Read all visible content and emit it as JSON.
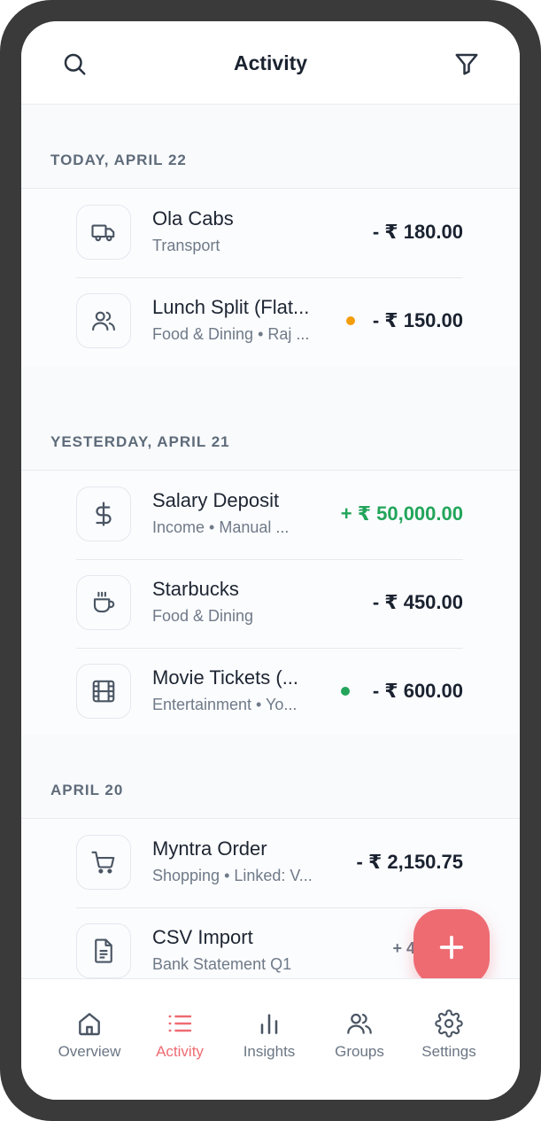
{
  "header": {
    "title": "Activity"
  },
  "icons": {
    "search": "search-icon",
    "filter": "filter-icon"
  },
  "sections": [
    {
      "label": "TODAY, APRIL 22",
      "items": [
        {
          "icon": "truck-icon",
          "title": "Ola Cabs",
          "subtitle": "Transport",
          "amount": "- ₹ 180.00"
        },
        {
          "icon": "users-icon",
          "title": "Lunch Split (Flat...",
          "subtitle": "Food & Dining • Raj ...",
          "amount": "- ₹ 150.00",
          "dot_color": "#f59e0b"
        }
      ]
    },
    {
      "label": "YESTERDAY, APRIL 21",
      "items": [
        {
          "icon": "dollar-icon",
          "title": "Salary Deposit",
          "subtitle": "Income • Manual ...",
          "amount": "+ ₹ 50,000.00",
          "positive": true
        },
        {
          "icon": "coffee-icon",
          "title": "Starbucks",
          "subtitle": "Food & Dining",
          "amount": "- ₹ 450.00"
        },
        {
          "icon": "film-icon",
          "title": "Movie Tickets (...",
          "subtitle": "Entertainment • Yo...",
          "amount": "- ₹ 600.00",
          "dot_color": "#22a55a"
        }
      ]
    },
    {
      "label": "APRIL 20",
      "items": [
        {
          "icon": "cart-icon",
          "title": "Myntra Order",
          "subtitle": "Shopping • Linked: V...",
          "amount": "- ₹ 2,150.75"
        },
        {
          "icon": "document-icon",
          "title": "CSV Import",
          "subtitle": "Bank Statement Q1",
          "amount": "+ 42"
        }
      ]
    }
  ],
  "fab": {
    "icon": "plus-icon"
  },
  "nav": [
    {
      "label": "Overview",
      "icon": "home-icon"
    },
    {
      "label": "Activity",
      "icon": "list-icon",
      "active": true
    },
    {
      "label": "Insights",
      "icon": "bar-chart-icon"
    },
    {
      "label": "Groups",
      "icon": "users-icon"
    },
    {
      "label": "Settings",
      "icon": "gear-icon"
    }
  ],
  "colors": {
    "accent": "#ee6b72",
    "positive": "#22a55a",
    "pending": "#f59e0b"
  }
}
